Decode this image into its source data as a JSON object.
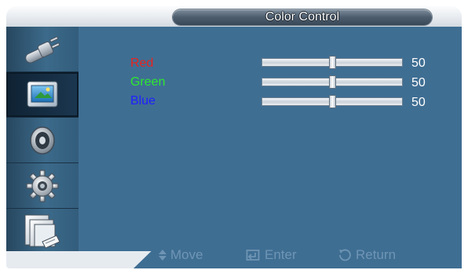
{
  "title": "Color Control",
  "sidebar": {
    "items": [
      {
        "name": "plug-icon",
        "selected": false
      },
      {
        "name": "picture-icon",
        "selected": true
      },
      {
        "name": "speaker-icon",
        "selected": false
      },
      {
        "name": "settings-gear-icon",
        "selected": false
      },
      {
        "name": "multi-window-icon",
        "selected": false
      }
    ]
  },
  "settings": [
    {
      "label": "Red",
      "value": "50",
      "color": "#e8231e",
      "level": 0.5
    },
    {
      "label": "Green",
      "value": "50",
      "color": "#2ee82e",
      "level": 0.5
    },
    {
      "label": "Blue",
      "value": "50",
      "color": "#2020ff",
      "level": 0.5
    }
  ],
  "footer": {
    "move": "Move",
    "enter": "Enter",
    "return": "Return"
  },
  "colors": {
    "content_bg": "#3f6e93",
    "hint_text": "#6f95b4"
  }
}
